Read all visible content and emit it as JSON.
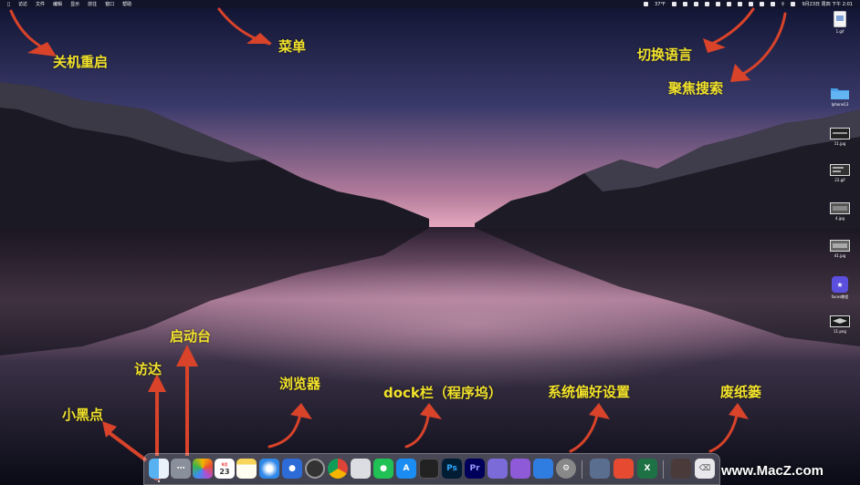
{
  "menubar": {
    "apple_icon": "apple-icon",
    "items": [
      "访达",
      "文件",
      "编辑",
      "显示",
      "前往",
      "窗口",
      "帮助"
    ],
    "status_text": "37°F",
    "datetime": "9月23日 周四 下午 2:01"
  },
  "desktop": {
    "files": [
      "1.gif",
      "Iphone13",
      "11.jpg",
      "22.gif",
      "4.jpg",
      "41.jpg",
      "faces教程",
      "11.png"
    ]
  },
  "annotations": {
    "shutdown": "关机重启",
    "menu": "菜单",
    "language": "切换语言",
    "spotlight": "聚焦搜索",
    "launchpad": "启动台",
    "finder": "访达",
    "dot": "小黑点",
    "browser": "浏览器",
    "dock": "dock栏（程序坞）",
    "prefs": "系统偏好设置",
    "trash": "废纸篓"
  },
  "dock": {
    "calendar_month": "9月",
    "calendar_day": "23",
    "apps": [
      "finder",
      "launchpad",
      "photos",
      "calendar",
      "notes",
      "safari",
      "chrome-alt",
      "clock",
      "chrome",
      "screen",
      "wechat",
      "appstore",
      "finalcut",
      "photoshop",
      "premiere",
      "unknown-a",
      "unknown-b",
      "browser-b",
      "preferences",
      "preview",
      "office-m",
      "excel",
      "desktop-folder",
      "trash"
    ],
    "ps_label": "Ps",
    "pr_label": "Pr"
  },
  "watermark": "www.MacZ.com",
  "colors": {
    "annotation": "#f2e22b",
    "arrow": "#d8432a"
  }
}
